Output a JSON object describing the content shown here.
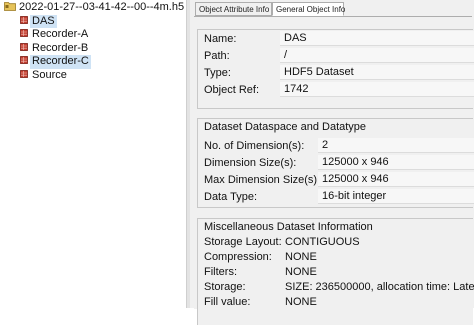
{
  "tree": {
    "root": "2022-01-27--03-41-42--00--4m.h5",
    "children": [
      "DAS",
      "Recorder-A",
      "Recorder-B",
      "Recorder-C",
      "Source"
    ]
  },
  "tabs": [
    "Object Attribute Info",
    "General Object Info"
  ],
  "general": {
    "name_label": "Name:",
    "name_value": "DAS",
    "path_label": "Path:",
    "path_value": "/",
    "type_label": "Type:",
    "type_value": "HDF5 Dataset",
    "ref_label": "Object Ref:",
    "ref_value": "1742"
  },
  "dataspace": {
    "title": "Dataset Dataspace and Datatype",
    "dims_label": "No. of Dimension(s):",
    "dims_value": "2",
    "size_label": "Dimension Size(s):",
    "size_value": "125000 x 946",
    "maxsize_label": "Max Dimension Size(s):",
    "maxsize_value": "125000 x 946",
    "dtype_label": "Data Type:",
    "dtype_value": "16-bit integer"
  },
  "misc": {
    "title": "Miscellaneous Dataset Information",
    "layout_label": "Storage Layout:",
    "layout_value": "CONTIGUOUS",
    "compression_label": "Compression:",
    "compression_value": "NONE",
    "filters_label": "Filters:",
    "filters_value": "NONE",
    "storage_label": "Storage:",
    "storage_value": "SIZE: 236500000, allocation time: Late",
    "fill_label": "Fill value:",
    "fill_value": "NONE"
  },
  "colors": {
    "selection": "#cfe3f5",
    "panel": "#f0f0f0",
    "icon_red": "#c43d2f",
    "folder": "#d9b24c"
  },
  "icons": {
    "root": "folder-icon",
    "dataset": "dataset-icon"
  }
}
